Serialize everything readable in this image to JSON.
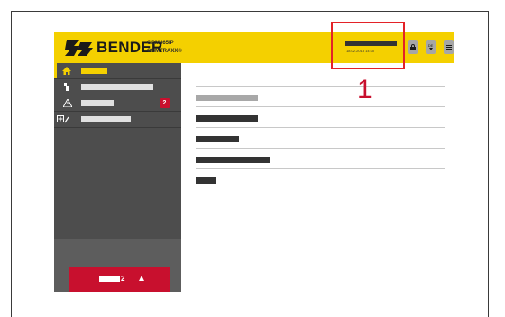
{
  "header": {
    "brand": "BENDER",
    "device_model": "COM465IP",
    "device_name": "COMTRAXX®",
    "datetime": "18.02.2013 14:30",
    "language": "DE",
    "colors": {
      "header_bg": "#f4d000",
      "button_bg": "#a6a6a6"
    }
  },
  "sidebar": {
    "items": [
      {
        "icon": "home-icon",
        "badge": ""
      },
      {
        "icon": "devices-icon",
        "badge": ""
      },
      {
        "icon": "alarm-icon",
        "badge": "2"
      },
      {
        "icon": "tools-icon",
        "badge": ""
      }
    ],
    "alarm_button": {
      "count": "2"
    },
    "colors": {
      "sidebar_bg": "#4d4d4d",
      "active": "#f4d000",
      "alert": "#c8102e"
    }
  },
  "callout": {
    "number": "1",
    "color": "#e32228"
  }
}
